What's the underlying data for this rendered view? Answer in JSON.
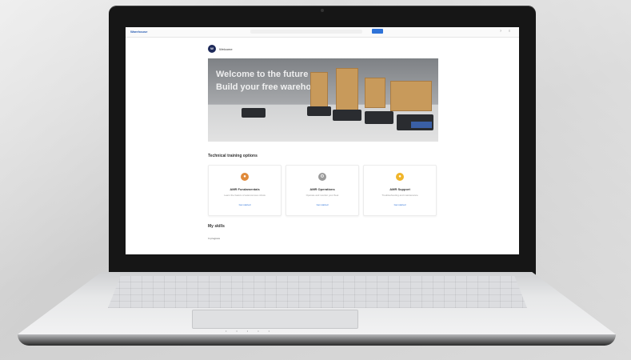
{
  "app": {
    "logo_text": "Warehouse",
    "search_placeholder": "",
    "signin_label": "",
    "user_initial": "W",
    "user_name": "Welcome"
  },
  "hero": {
    "line1": "Welcome to the future",
    "line2": "Build your free warehouse"
  },
  "training": {
    "section_title": "Technical training options",
    "cards": [
      {
        "title": "AMR Fundamentals",
        "desc": "Learn the basics of autonomous robots",
        "link": "Get started",
        "icon": "robot-icon",
        "color": "#e08a3a"
      },
      {
        "title": "AMR Operations",
        "desc": "Operate and monitor your fleet",
        "link": "Get started",
        "icon": "gear-icon",
        "color": "#9a9a9a"
      },
      {
        "title": "AMR Support",
        "desc": "Troubleshooting and maintenance",
        "link": "Get started",
        "icon": "lightbulb-icon",
        "color": "#f0b52a"
      }
    ]
  },
  "section2": {
    "title": "My skills",
    "item": "In progress"
  },
  "colors": {
    "accent": "#2f73d8",
    "avatar": "#1e2a5a"
  }
}
